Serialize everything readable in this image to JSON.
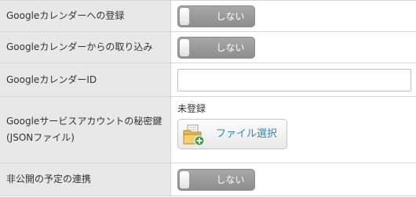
{
  "rows": [
    {
      "label": "Googleカレンダーへの登録",
      "toggle_text": "しない"
    },
    {
      "label": "Googleカレンダーからの取り込み",
      "toggle_text": "しない"
    },
    {
      "label": "GoogleカレンダーID",
      "input_value": "",
      "input_placeholder": ""
    },
    {
      "label_line1": "Googleサービスアカウントの秘密鍵",
      "label_line2": "(JSONファイル)",
      "status": "未登録",
      "file_button_label": "ファイル選択"
    },
    {
      "label": "非公開の予定の連携",
      "toggle_text": "しない"
    }
  ],
  "colors": {
    "label_bg": "#e8e8e8",
    "toggle_bg": "#999999",
    "link_blue": "#2a8bb8",
    "border": "#d6d6d6"
  },
  "icons": {
    "file_button_icon": "folder-add-icon"
  }
}
